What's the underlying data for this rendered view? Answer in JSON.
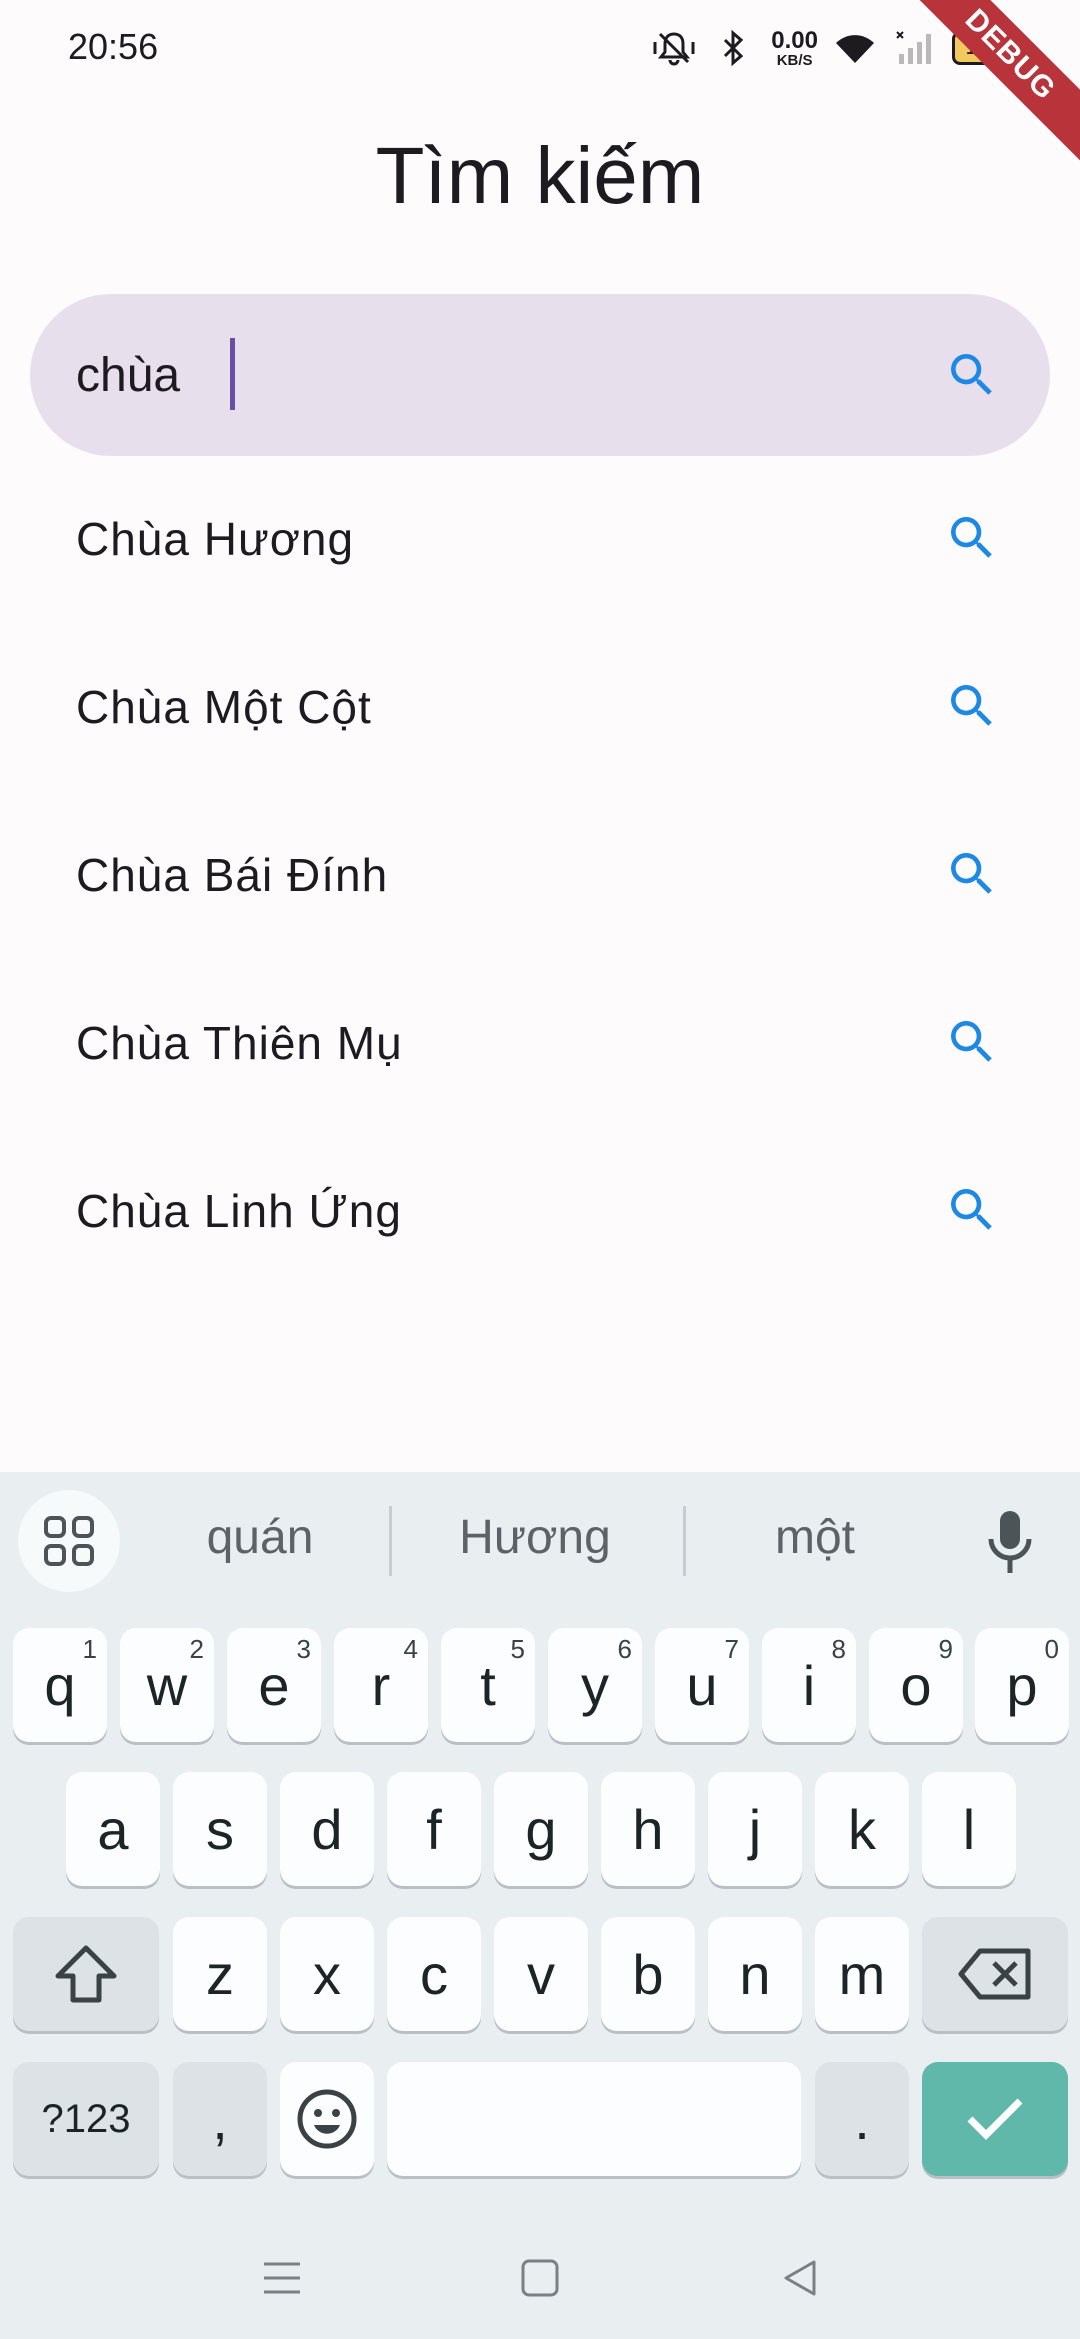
{
  "status_bar": {
    "time": "20:56",
    "net_speed_value": "0.00",
    "net_speed_unit": "KB/S",
    "battery_level": "100",
    "debug_banner": "DEBUG"
  },
  "page": {
    "title": "Tìm kiếm"
  },
  "search": {
    "query": "chùa"
  },
  "suggestions": [
    {
      "label": "Chùa Hương"
    },
    {
      "label": "Chùa Một Cột"
    },
    {
      "label": "Chùa Bái Đính"
    },
    {
      "label": "Chùa Thiên Mụ"
    },
    {
      "label": "Chùa Linh Ứng"
    }
  ],
  "keyboard": {
    "word_suggestions": [
      "quán",
      "Hương",
      "một"
    ],
    "row1": [
      {
        "k": "q",
        "h": "1"
      },
      {
        "k": "w",
        "h": "2"
      },
      {
        "k": "e",
        "h": "3"
      },
      {
        "k": "r",
        "h": "4"
      },
      {
        "k": "t",
        "h": "5"
      },
      {
        "k": "y",
        "h": "6"
      },
      {
        "k": "u",
        "h": "7"
      },
      {
        "k": "i",
        "h": "8"
      },
      {
        "k": "o",
        "h": "9"
      },
      {
        "k": "p",
        "h": "0"
      }
    ],
    "row2": [
      "a",
      "s",
      "d",
      "f",
      "g",
      "h",
      "j",
      "k",
      "l"
    ],
    "row3": [
      "z",
      "x",
      "c",
      "v",
      "b",
      "n",
      "m"
    ],
    "symbols_label": "?123",
    "comma_label": ",",
    "period_label": "."
  },
  "colors": {
    "accent_icon": "#1e88e5",
    "search_bar_bg": "#e7e0ec",
    "caret": "#6750a4",
    "enter_key": "#5fb8a9"
  }
}
